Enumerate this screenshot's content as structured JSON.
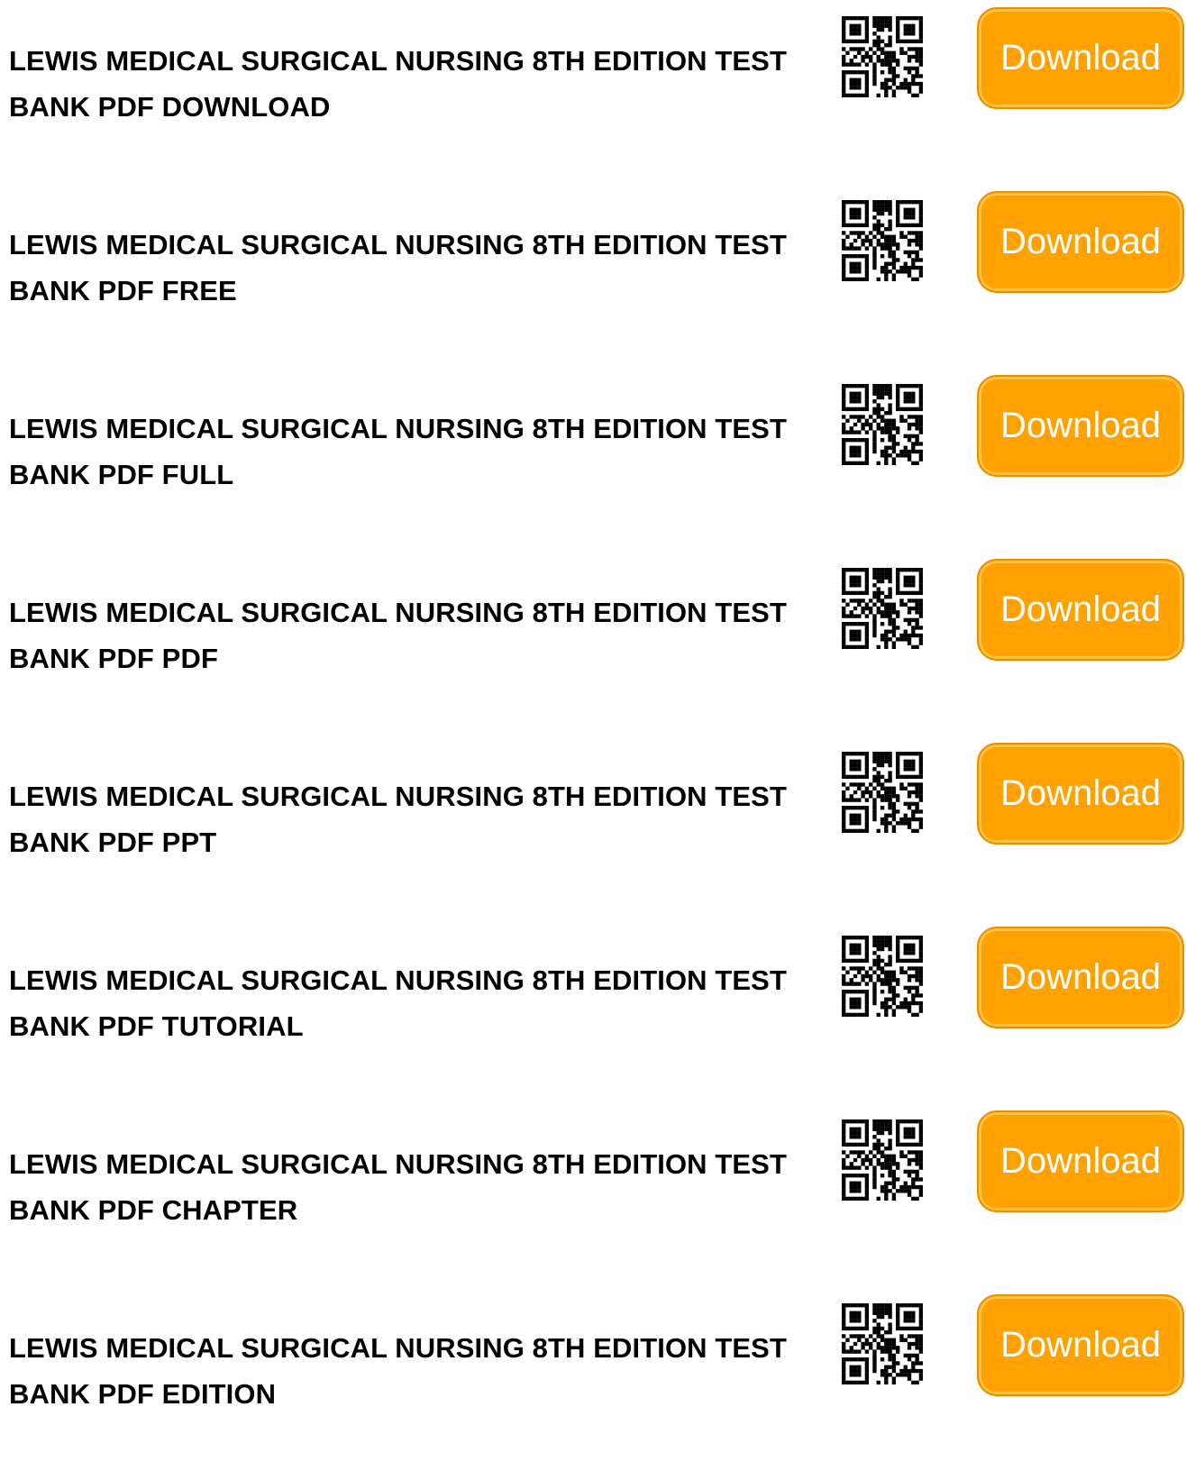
{
  "rows": [
    {
      "title": "LEWIS MEDICAL SURGICAL NURSING 8TH EDITION TEST BANK PDF DOWNLOAD",
      "button_label": "Download",
      "qr_icon": "qr-code-icon"
    },
    {
      "title": "LEWIS MEDICAL SURGICAL NURSING 8TH EDITION TEST BANK PDF FREE",
      "button_label": "Download",
      "qr_icon": "qr-code-icon"
    },
    {
      "title": "LEWIS MEDICAL SURGICAL NURSING 8TH EDITION TEST BANK PDF FULL",
      "button_label": "Download",
      "qr_icon": "qr-code-icon"
    },
    {
      "title": "LEWIS MEDICAL SURGICAL NURSING 8TH EDITION TEST BANK PDF PDF",
      "button_label": "Download",
      "qr_icon": "qr-code-icon"
    },
    {
      "title": "LEWIS MEDICAL SURGICAL NURSING 8TH EDITION TEST BANK PDF PPT",
      "button_label": "Download",
      "qr_icon": "qr-code-icon"
    },
    {
      "title": "LEWIS MEDICAL SURGICAL NURSING 8TH EDITION TEST BANK PDF TUTORIAL",
      "button_label": "Download",
      "qr_icon": "qr-code-icon"
    },
    {
      "title": "LEWIS MEDICAL SURGICAL NURSING 8TH EDITION TEST BANK PDF CHAPTER",
      "button_label": "Download",
      "qr_icon": "qr-code-icon"
    },
    {
      "title": "LEWIS MEDICAL SURGICAL NURSING 8TH EDITION TEST BANK PDF EDITION",
      "button_label": "Download",
      "qr_icon": "qr-code-icon"
    }
  ],
  "colors": {
    "button_fill": "#ffa200",
    "button_border": "#e88e00",
    "button_text": "#ffffff",
    "title_text": "#000000"
  }
}
